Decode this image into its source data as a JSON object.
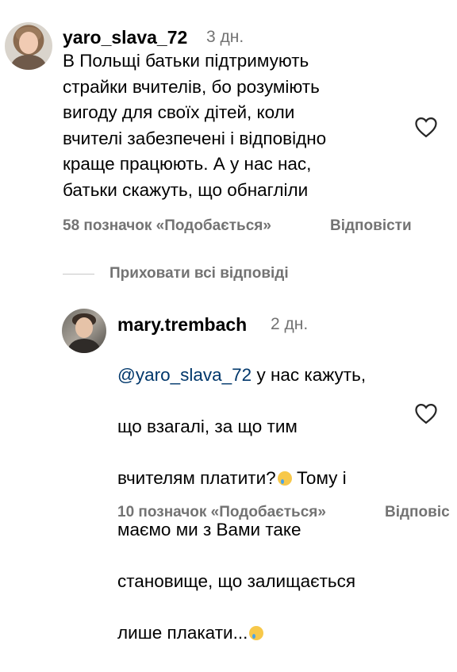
{
  "comment1": {
    "username": "yaro_slava_72",
    "time": "3 дн.",
    "text": "В Польщі батьки підтримують\nстрайки вчителів, бо розуміють\nвигоду для своїх дітей, коли\nвчителі забезпечені і відповідно\nкраще працюють. А у нас нас,\nбатьки скажуть, що обнагліли",
    "likes": "58 позначок «Подобається»",
    "reply": "Відповісти"
  },
  "replies_toggle": "Приховати всі відповіді",
  "comment2": {
    "username": "mary.trembach",
    "time": "2 дн.",
    "mention": "@yaro_slava_72",
    "line1_rest": " у нас кажуть,",
    "line2": "що взагалі, за що тим",
    "line3": "вчителям платити?",
    "line3_after": " Тому і",
    "line4": "маємо ми з Вами таке",
    "line5": "становище, що залищається",
    "line6": "лише плакати...",
    "likes": "10 позначок «Подобається»",
    "reply": "Відповіс"
  },
  "icons": {
    "like": "heart-outline-icon",
    "emoji": "crying-face-emoji"
  }
}
